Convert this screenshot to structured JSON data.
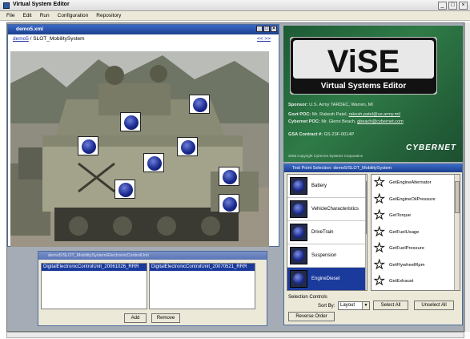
{
  "app": {
    "title": "Virtual System Editor"
  },
  "window_controls": {
    "minimize": "_",
    "maximize": "□",
    "close": "×"
  },
  "menu": {
    "items": [
      "File",
      "Edit",
      "Run",
      "Configuration",
      "Repository"
    ]
  },
  "demo_window": {
    "title": "demo5.xml",
    "breadcrumb_link": "demo5",
    "breadcrumb_rest": " / SLOT_MobilitySystem",
    "nav": "<< >>",
    "test_point_count": 9
  },
  "system_window": {
    "title": "demo5/SLOT_MobilitySystem/ElectronicControlUnit",
    "left_selected": "DigitalElectronicControlUnit_20061026_RRR",
    "right_selected": "DigitalElectronicControlUnit_20070521_RRR",
    "add_label": "Add",
    "remove_label": "Remove"
  },
  "banner": {
    "logo": "ViSE",
    "subtitle": "Virtual Systems Editor",
    "sponsor_label": "Sponsor:",
    "sponsor_value": "U.S. Army TARDEC, Warren, MI",
    "govt_label": "Govt POC:",
    "govt_value": "Mr. Rakesh Patel,",
    "govt_email": "rakesh.patel@us.army.mil",
    "cyber_label": "Cybernet POC:",
    "cyber_value": "Mr. Glenn Beach,",
    "cyber_email": "gbeach@cybernet.com",
    "gsa_label": "GSA Contract #:",
    "gsa_value": "GS-23F-0014P",
    "copyright": "2006 Copyright Cybernet Systems Corporation",
    "brand": "CYBERNET"
  },
  "test_point_selection": {
    "title": "Test Point Selection: demo5/SLOT_MobilitySystem",
    "subsystems": [
      {
        "label": "Battery"
      },
      {
        "label": "VehicleCharacteristics"
      },
      {
        "label": "DriveTrain"
      },
      {
        "label": "Suspension"
      },
      {
        "label": "EngineDiesel"
      }
    ],
    "selected_subsystem": "EngineDiesel",
    "functions": [
      {
        "label": "GetEngineAlternator"
      },
      {
        "label": "GetEngineOilPressure"
      },
      {
        "label": "GetTorque"
      },
      {
        "label": "GetFuelUsage"
      },
      {
        "label": "GetFuelPressure"
      },
      {
        "label": "GetFlywheelRpm"
      },
      {
        "label": "GetExhaust"
      }
    ],
    "selection_controls_label": "Selection Controls",
    "sort_by_label": "Sort By:",
    "sort_value": "Layout",
    "select_all_label": "Select All",
    "unselect_all_label": "Unselect All",
    "reverse_order_label": "Reverse Order"
  }
}
